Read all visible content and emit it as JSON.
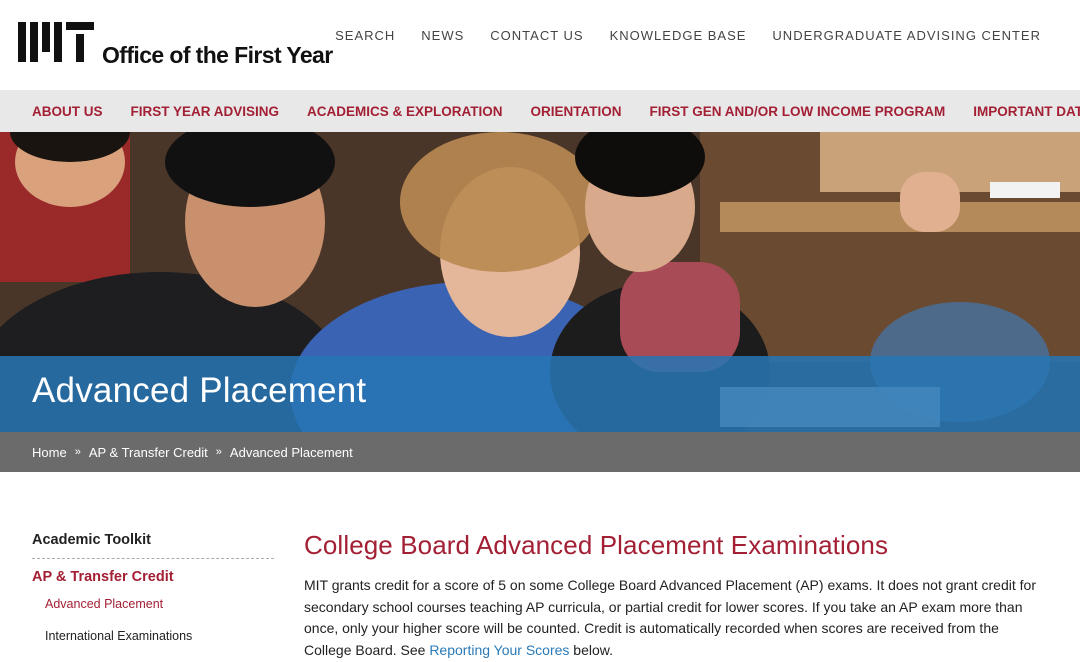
{
  "header": {
    "logo_text": "Office of the First Year",
    "utility_nav": [
      "SEARCH",
      "NEWS",
      "CONTACT US",
      "KNOWLEDGE BASE",
      "UNDERGRADUATE ADVISING CENTER"
    ]
  },
  "main_nav": [
    "ABOUT US",
    "FIRST YEAR ADVISING",
    "ACADEMICS & EXPLORATION",
    "ORIENTATION",
    "FIRST GEN AND/OR LOW INCOME PROGRAM",
    "IMPORTANT DATES"
  ],
  "hero": {
    "title": "Advanced Placement"
  },
  "breadcrumb": {
    "items": [
      "Home",
      "AP & Transfer Credit",
      "Advanced Placement"
    ],
    "separator": "»"
  },
  "sidebar": {
    "heading": "Academic Toolkit",
    "section": "AP & Transfer Credit",
    "items": [
      "Advanced Placement",
      "International Examinations"
    ]
  },
  "content": {
    "title": "College Board Advanced Placement Examinations",
    "paragraph_text": "MIT grants credit for a score of 5 on some College Board Advanced Placement (AP) exams. It does not grant credit for secondary school courses teaching AP curricula, or partial credit for lower scores. If you take an AP exam more than once, only your higher score will be counted.  Credit is automatically recorded when scores are received from the College Board. See ",
    "link_text": "Reporting Your Scores",
    "paragraph_end": " below."
  },
  "colors": {
    "brand_red": "#a31f34",
    "hero_band": "#2776b4",
    "breadcrumb_bg": "#6b6b6b",
    "nav_bg": "#e8e8e8",
    "link": "#2a7ab8"
  }
}
